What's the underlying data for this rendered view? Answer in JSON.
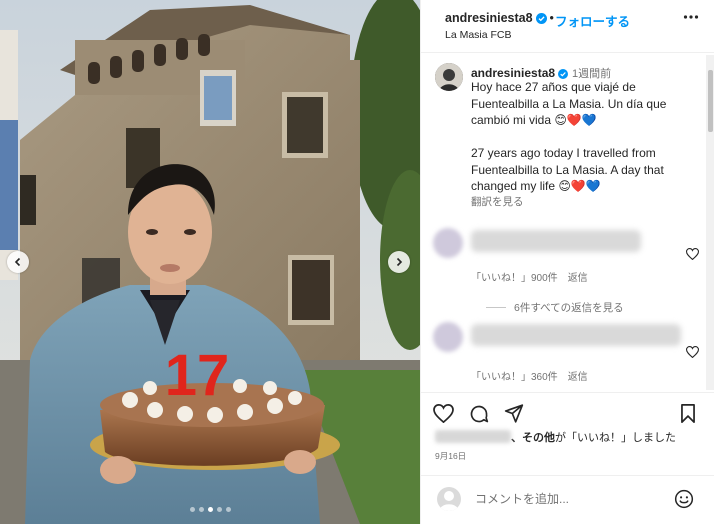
{
  "header": {
    "username": "andresiniesta8",
    "separator": "•",
    "follow_label": "フォローする",
    "location": "La Masia FCB"
  },
  "photo": {
    "candles_text": "17",
    "slide_count": 5,
    "active_slide": 2
  },
  "caption": {
    "username": "andresiniesta8",
    "time": "1週間前",
    "text": "Hoy hace 27 años que viajé de Fuentealbilla a La Masia. Un día que cambió mi vida 😊❤️💙\n\n27 years ago today I travelled from Fuentealbilla to La Masia. A day that changed my life 😊❤️💙",
    "translate_label": "翻訳を見る"
  },
  "comments": [
    {
      "like_label": "「いいね！」900件",
      "reply_label": "返信"
    },
    {
      "like_label": "「いいね！」360件",
      "reply_label": "返信"
    }
  ],
  "see_replies_label": "6件すべての返信を見る",
  "likes": {
    "suffix_bold": "、その他",
    "suffix_text": "が「いいね！」しました"
  },
  "date": "9月16日",
  "comment_input": {
    "placeholder": "コメントを追加..."
  },
  "icons": [
    "verified-icon",
    "more-icon",
    "heart-icon",
    "comment-icon",
    "share-icon",
    "bookmark-icon",
    "emoji-icon",
    "chevron-left-icon",
    "chevron-right-icon"
  ],
  "colors": {
    "link_blue": "#0095f6",
    "verified_blue": "#0095f6",
    "candle_red": "#e0251c"
  }
}
